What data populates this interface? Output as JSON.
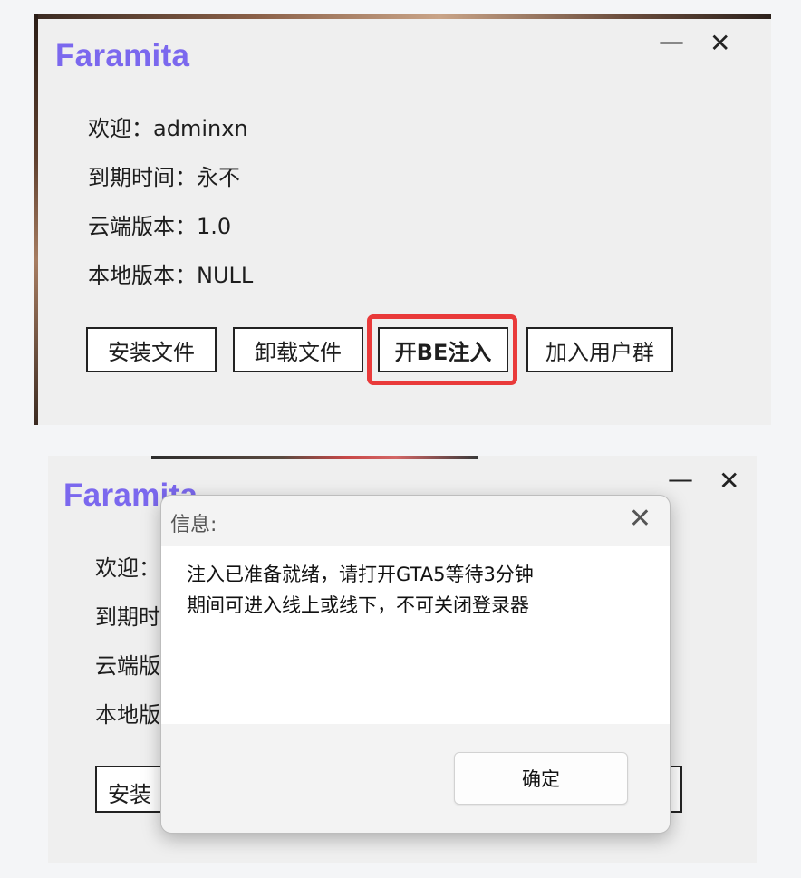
{
  "top_window": {
    "title": "Faramita",
    "minimize": "—",
    "close": "✕",
    "welcome": "欢迎：adminxn",
    "expire": "到期时间：永不",
    "cloud_version": "云端版本：1.0",
    "local_version": "本地版本：NULL",
    "buttons": {
      "install": "安装文件",
      "uninstall": "卸载文件",
      "inject": "开BE注入",
      "join_group": "加入用户群"
    },
    "highlight_color": "#e93a3a"
  },
  "bottom_window": {
    "title": "Faramita",
    "minimize": "—",
    "close": "✕",
    "clipped_lines": [
      "欢迎：",
      "到期时",
      "云端版",
      "本地版"
    ],
    "clipped_button": "安装"
  },
  "dialog": {
    "title": "信息:",
    "close": "✕",
    "message_line1": "注入已准备就绪，请打开GTA5等待3分钟",
    "message_line2": "期间可进入线上或线下，不可关闭登录器",
    "ok_button": "确定"
  },
  "colors": {
    "accent": "#7b68ee",
    "background": "#f4f5f7",
    "panel": "#efefef"
  }
}
